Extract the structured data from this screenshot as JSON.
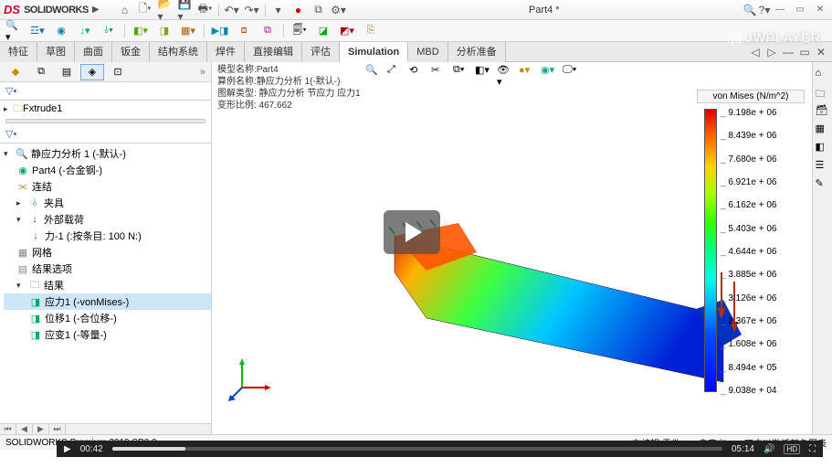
{
  "app": {
    "logo_ds": "DS",
    "logo_text": "SOLIDWORKS",
    "doc_title": "Part4 *",
    "watermark": "JWPLAYER"
  },
  "tabs": [
    "特征",
    "草图",
    "曲面",
    "钣金",
    "结构系统",
    "焊件",
    "直接编辑",
    "评估",
    "Simulation",
    "MBD",
    "分析准备"
  ],
  "tabs_active_index": 8,
  "vp_info": {
    "l1": "模型名称:Part4",
    "l2": "算例名称:静应力分析 1(-默认-)",
    "l3": "图解类型: 静应力分析 节应力 应力1",
    "l4": "变形比例: 467.662"
  },
  "config_row": "Fxtrude1",
  "tree": {
    "root": "静应力分析 1 (-默认-)",
    "part": "Part4 (-合金钢-)",
    "conn": "连结",
    "fix": "夹具",
    "load": "外部载荷",
    "force": "力-1 (:按条目: 100 N:)",
    "mesh": "网格",
    "resopt": "结果选项",
    "results": "结果",
    "r1": "应力1 (-vonMises-)",
    "r2": "位移1 (-合位移-)",
    "r3": "应变1 (-等量-)"
  },
  "legend": {
    "title": "von Mises (N/m^2)",
    "values": [
      "9.198e + 06",
      "8.439e + 06",
      "7.680e + 06",
      "6.921e + 06",
      "6.162e + 06",
      "5.403e + 06",
      "4.644e + 06",
      "3.885e + 06",
      "3.126e + 06",
      "2.367e + 06",
      "1.608e + 06",
      "8.494e + 05",
      "9.038e + 04"
    ]
  },
  "status": {
    "left": "SOLIDWORKS Premium 2019 SP0.0",
    "s1": "在编辑 零件",
    "s2": "自定义",
    "s3": "双击以激活颜色图表"
  },
  "player": {
    "cur": "00:42",
    "tot": "05:14",
    "hd": "HD"
  }
}
